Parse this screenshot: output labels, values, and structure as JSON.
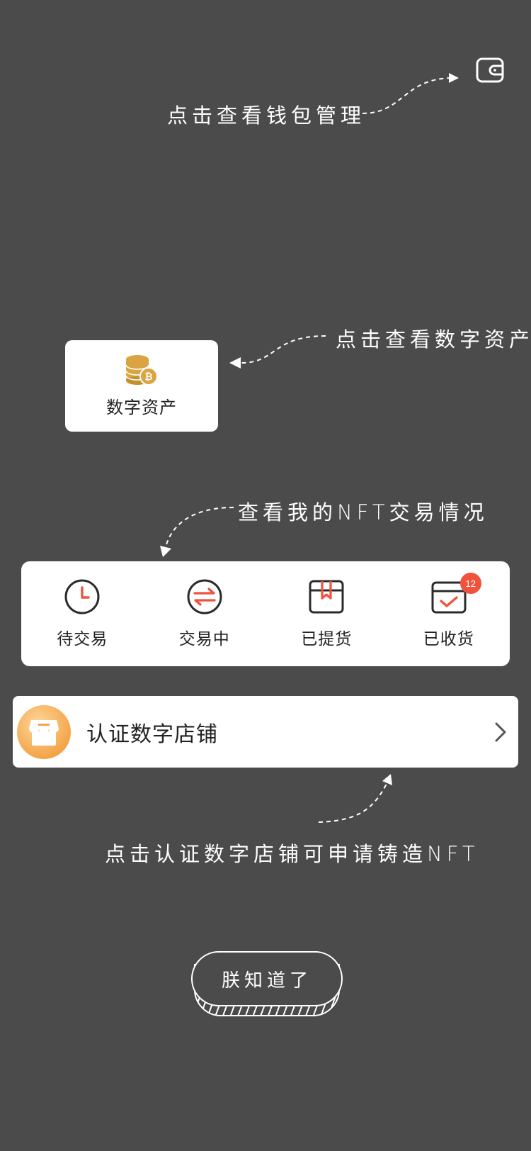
{
  "hints": {
    "wallet": "点击查看钱包管理",
    "assets": "点击查看数字资产",
    "nft": "查看我的NFT交易情况",
    "shop": "点击认证数字店铺可申请铸造NFT"
  },
  "wallet_icon": "wallet-icon",
  "asset_card": {
    "label": "数字资产",
    "icon": "coins-bitcoin-icon"
  },
  "orders": [
    {
      "label": "待交易",
      "icon": "clock-icon"
    },
    {
      "label": "交易中",
      "icon": "exchange-icon"
    },
    {
      "label": "已提货",
      "icon": "box-icon"
    },
    {
      "label": "已收货",
      "icon": "received-check-icon",
      "badge": "12"
    }
  ],
  "shop": {
    "title": "认证数字店铺",
    "icon": "store-icon"
  },
  "got_it": "朕知道了",
  "colors": {
    "overlay": "#4b4b4b",
    "accent": "#f0523b",
    "gold": "#d9a441",
    "shop_orange": "#f3a54a"
  }
}
